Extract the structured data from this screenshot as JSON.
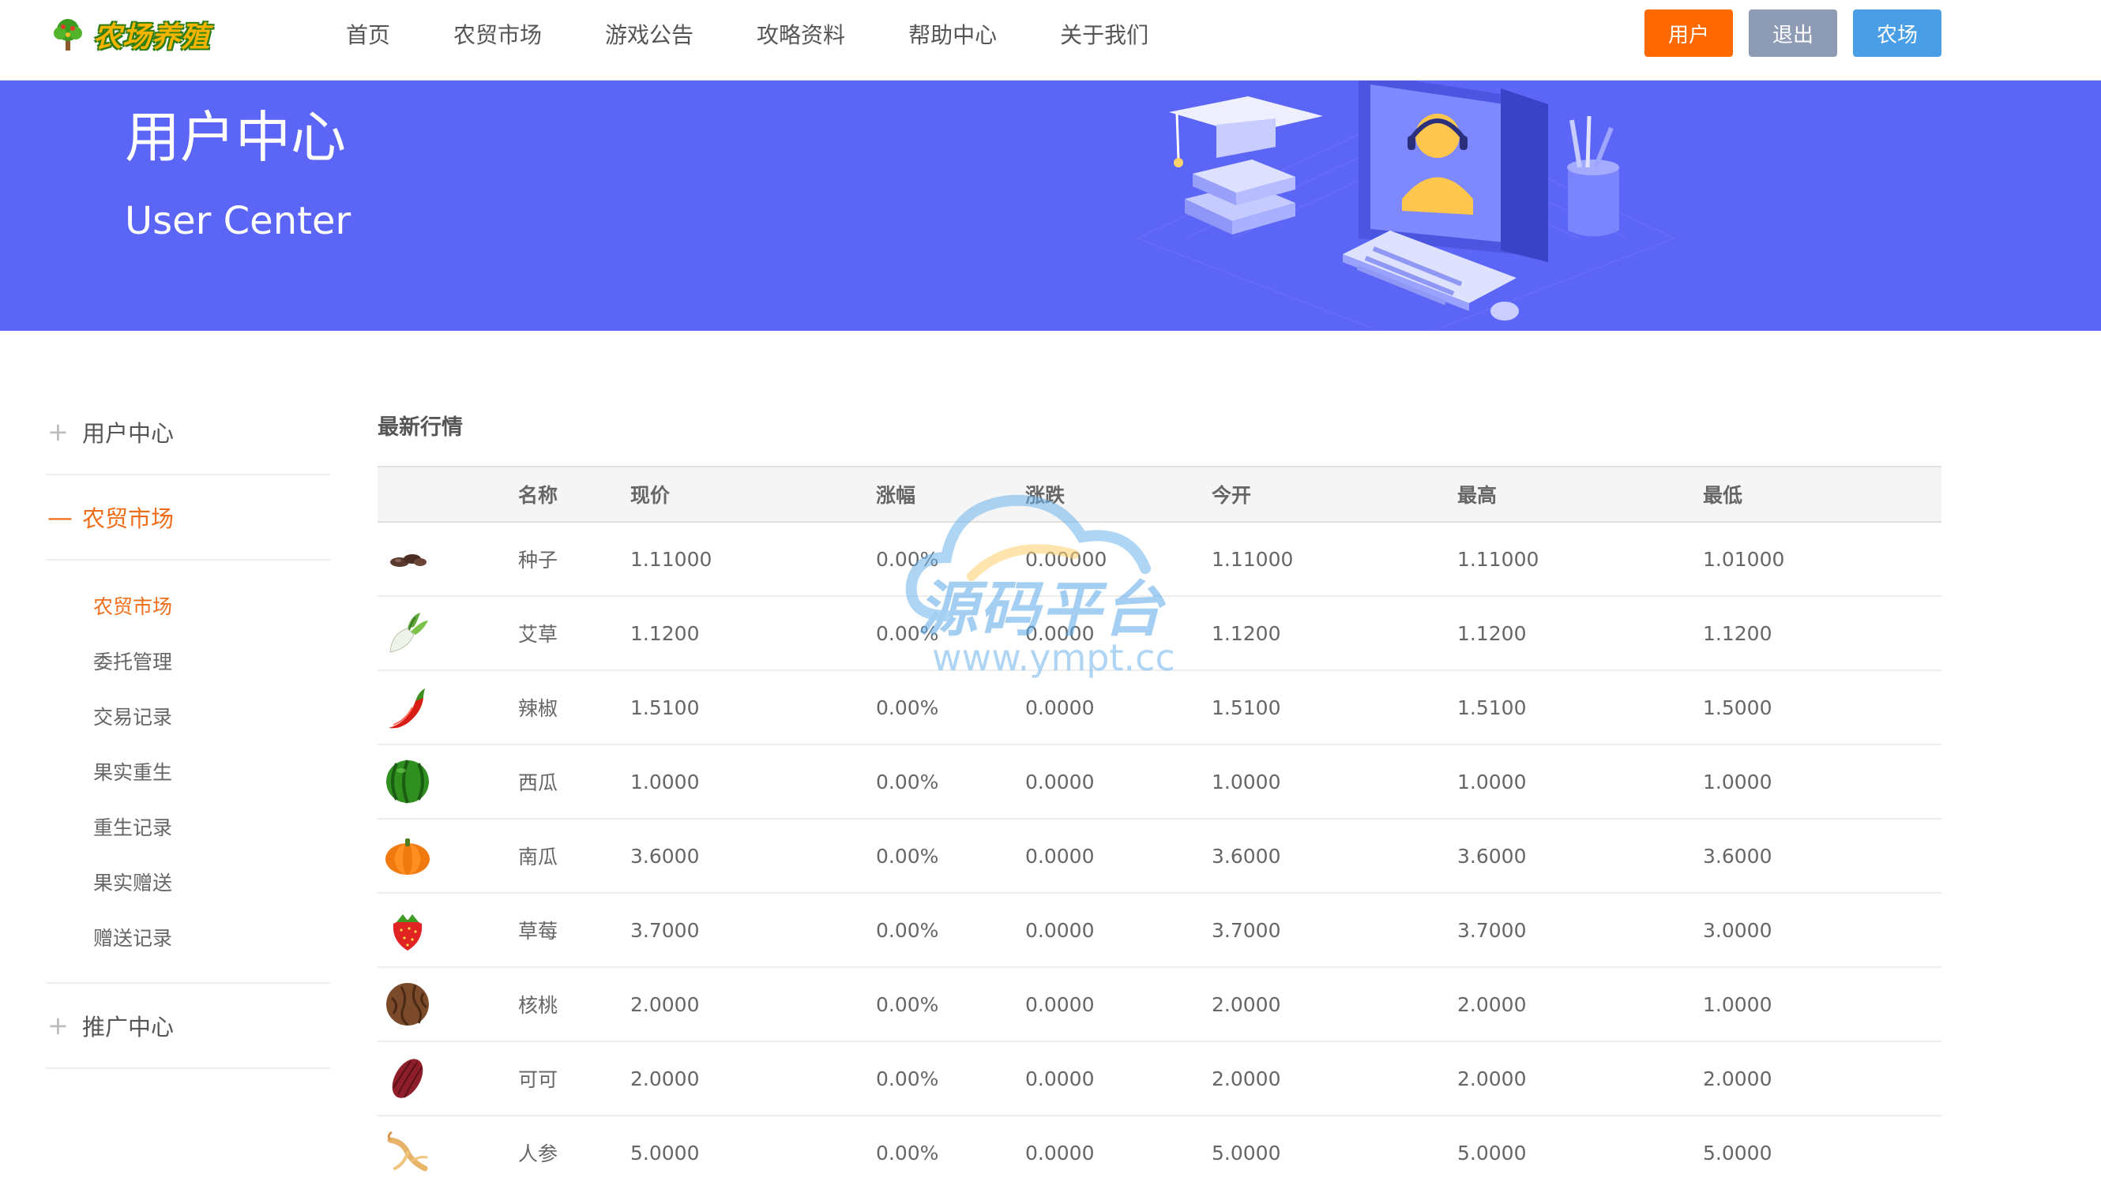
{
  "header": {
    "logo_text": "农场养殖",
    "nav": [
      "首页",
      "农贸市场",
      "游戏公告",
      "攻略资料",
      "帮助中心",
      "关于我们"
    ],
    "buttons": {
      "user": "用户",
      "logout": "退出",
      "farm": "农场"
    }
  },
  "banner": {
    "title": "用户中心",
    "subtitle": "User Center"
  },
  "sidebar": {
    "groups": [
      {
        "label": "用户中心",
        "mark": "+"
      },
      {
        "label": "农贸市场",
        "mark": "—"
      },
      {
        "label": "推广中心",
        "mark": "+"
      }
    ],
    "sub_items": [
      "农贸市场",
      "委托管理",
      "交易记录",
      "果实重生",
      "重生记录",
      "果实赠送",
      "赠送记录"
    ]
  },
  "market": {
    "title": "最新行情",
    "columns": [
      "",
      "名称",
      "现价",
      "涨幅",
      "涨跌",
      "今开",
      "最高",
      "最低"
    ],
    "rows": [
      {
        "icon": "seed-icon",
        "name": "种子",
        "price": "1.11000",
        "rate": "0.00%",
        "change": "0.00000",
        "open": "1.11000",
        "high": "1.11000",
        "low": "1.01000"
      },
      {
        "icon": "radish-icon",
        "name": "艾草",
        "price": "1.1200",
        "rate": "0.00%",
        "change": "0.0000",
        "open": "1.1200",
        "high": "1.1200",
        "low": "1.1200"
      },
      {
        "icon": "chili-icon",
        "name": "辣椒",
        "price": "1.5100",
        "rate": "0.00%",
        "change": "0.0000",
        "open": "1.5100",
        "high": "1.5100",
        "low": "1.5000"
      },
      {
        "icon": "watermelon-icon",
        "name": "西瓜",
        "price": "1.0000",
        "rate": "0.00%",
        "change": "0.0000",
        "open": "1.0000",
        "high": "1.0000",
        "low": "1.0000"
      },
      {
        "icon": "pumpkin-icon",
        "name": "南瓜",
        "price": "3.6000",
        "rate": "0.00%",
        "change": "0.0000",
        "open": "3.6000",
        "high": "3.6000",
        "low": "3.6000"
      },
      {
        "icon": "strawberry-icon",
        "name": "草莓",
        "price": "3.7000",
        "rate": "0.00%",
        "change": "0.0000",
        "open": "3.7000",
        "high": "3.7000",
        "low": "3.0000"
      },
      {
        "icon": "walnut-icon",
        "name": "核桃",
        "price": "2.0000",
        "rate": "0.00%",
        "change": "0.0000",
        "open": "2.0000",
        "high": "2.0000",
        "low": "1.0000"
      },
      {
        "icon": "cocoa-icon",
        "name": "可可",
        "price": "2.0000",
        "rate": "0.00%",
        "change": "0.0000",
        "open": "2.0000",
        "high": "2.0000",
        "low": "2.0000"
      },
      {
        "icon": "ginseng-icon",
        "name": "人参",
        "price": "5.0000",
        "rate": "0.00%",
        "change": "0.0000",
        "open": "5.0000",
        "high": "5.0000",
        "low": "5.0000"
      }
    ]
  },
  "watermark": {
    "text": "源码平台",
    "url": "www.ympt.cc"
  },
  "colors": {
    "accent": "#f06d1a",
    "banner": "#5b66f6",
    "btn_user": "#ff6a00",
    "btn_logout": "#8e9bb4",
    "btn_farm": "#4a9ee6"
  }
}
